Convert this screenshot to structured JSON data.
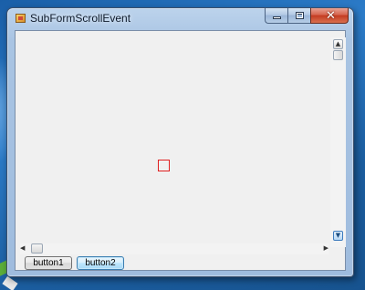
{
  "window": {
    "title": "SubFormScrollEvent"
  },
  "buttons": {
    "button1_label": "button1",
    "button2_label": "button2"
  },
  "scrollbars": {
    "up_arrow": "▲",
    "down_arrow": "▼",
    "left_arrow": "◀",
    "right_arrow": "▶"
  },
  "caption": {
    "close_glyph": "✕"
  },
  "colors": {
    "square_border": "#e02020",
    "focused_button_border": "#3c7fb1"
  }
}
